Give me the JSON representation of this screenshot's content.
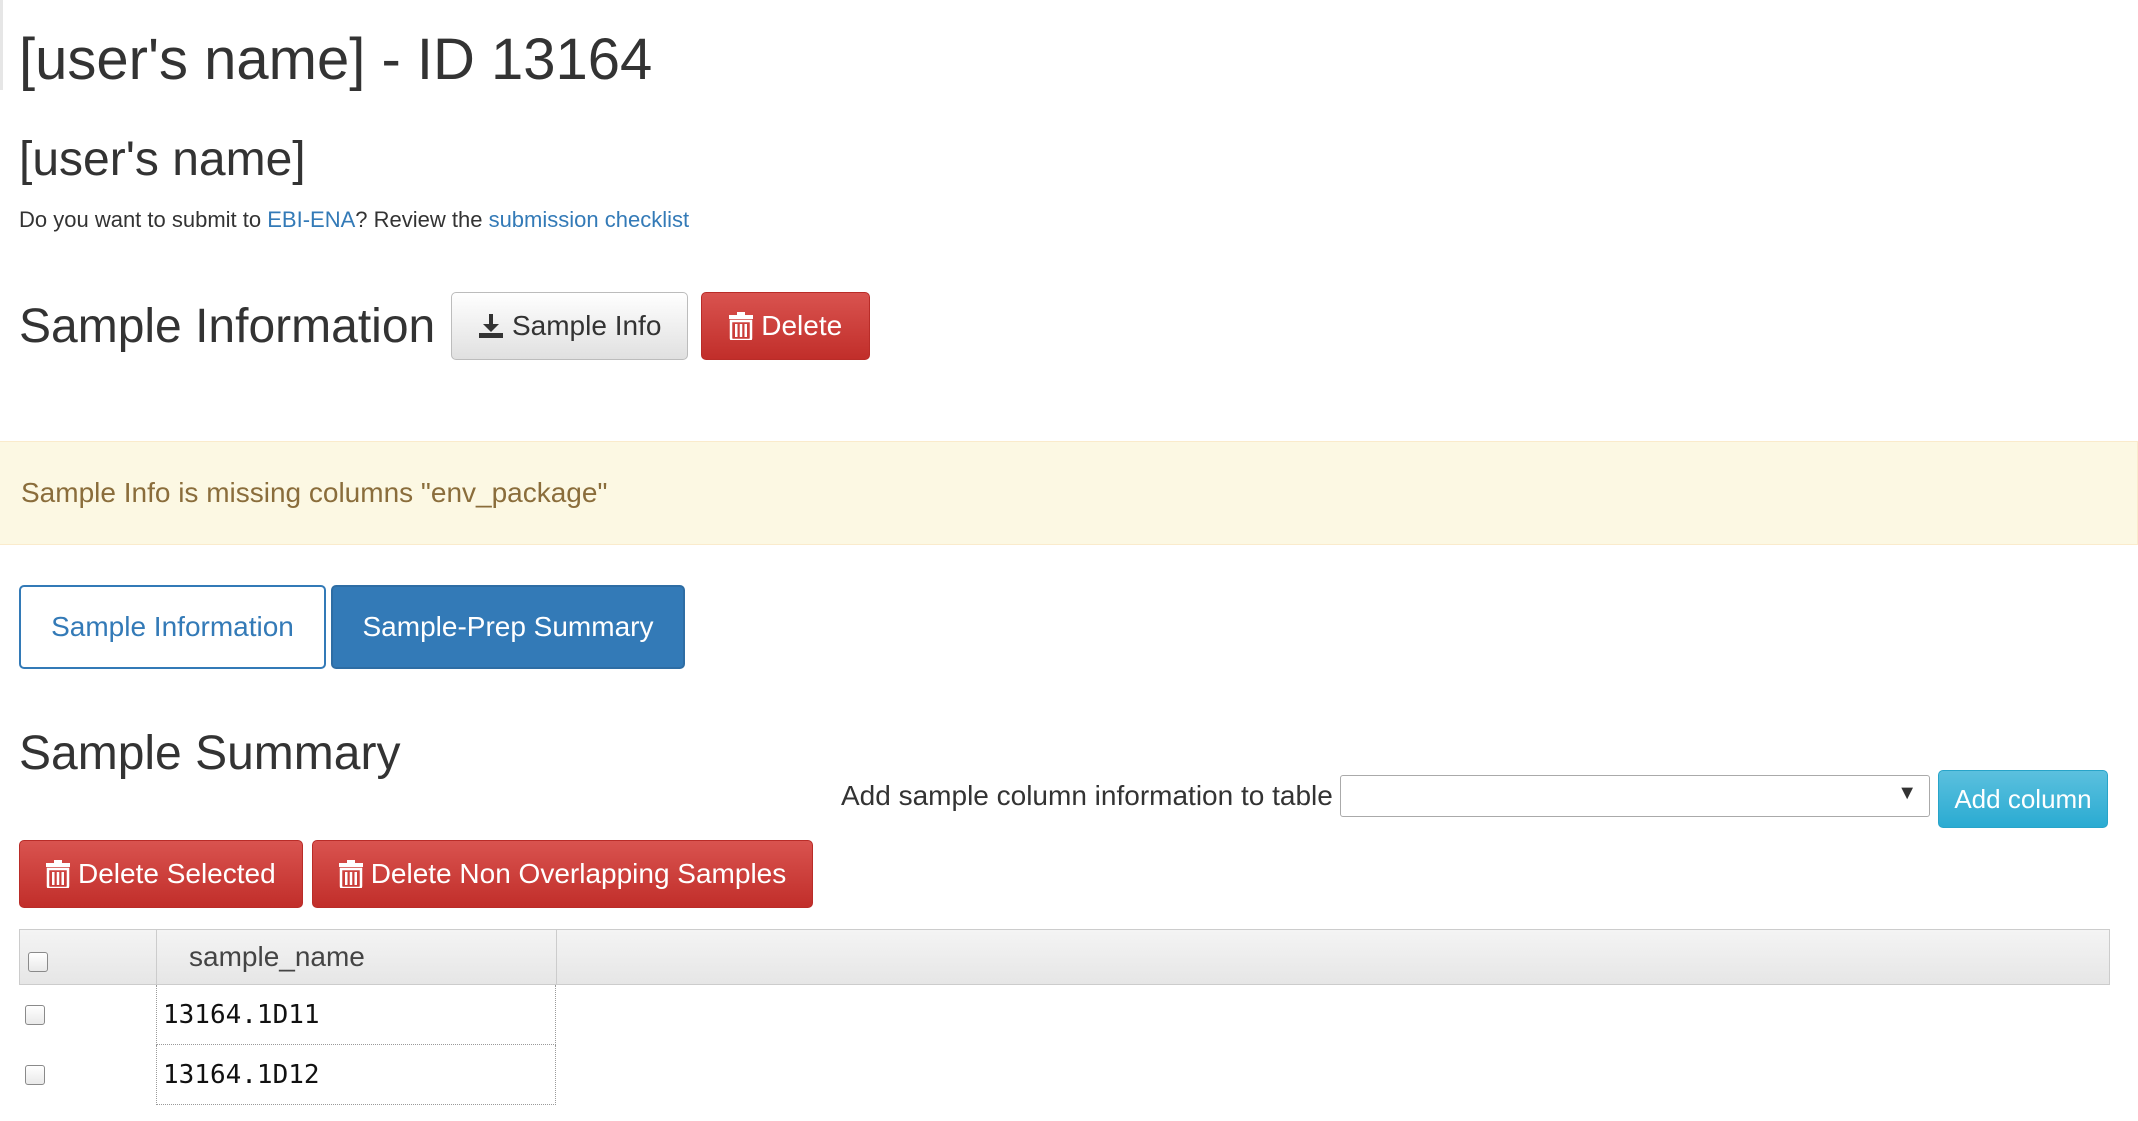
{
  "header": {
    "title": "[user's name] - ID 13164",
    "user_name": "[user's name]",
    "submit_prefix": "Do you want to submit to ",
    "submit_link": "EBI-ENA",
    "submit_middle": "? Review the ",
    "checklist_link": "submission checklist"
  },
  "sample_info": {
    "heading": "Sample Information",
    "download_label": "Sample Info",
    "delete_label": "Delete"
  },
  "warning": {
    "message": "Sample Info is missing columns \"env_package\""
  },
  "tabs": [
    {
      "label": "Sample Information",
      "active": false
    },
    {
      "label": "Sample-Prep Summary",
      "active": true
    }
  ],
  "summary": {
    "heading": "Sample Summary",
    "add_column_label": "Add sample column information to table",
    "add_column_selected": "",
    "add_column_button": "Add column",
    "delete_selected_label": "Delete Selected",
    "delete_non_overlapping_label": "Delete Non Overlapping Samples"
  },
  "table": {
    "columns": [
      "sample_name"
    ],
    "rows": [
      {
        "sample_name": "13164.1D11",
        "checked": false
      },
      {
        "sample_name": "13164.1D12",
        "checked": false
      }
    ]
  },
  "colors": {
    "primary": "#337ab7",
    "danger": "#d9534f",
    "info": "#5bc0de",
    "warning_bg": "#fcf8e3",
    "warning_text": "#8a6d3b"
  },
  "icons": {
    "download": "download-icon",
    "trash": "trash-icon",
    "dropdown": "chevron-down-icon"
  }
}
